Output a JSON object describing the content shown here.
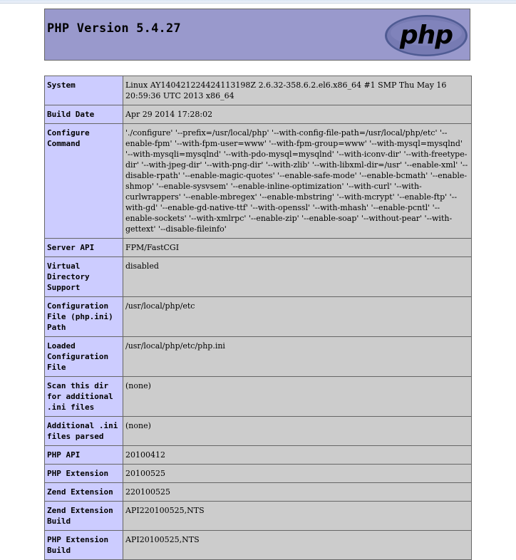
{
  "header": {
    "title": "PHP Version 5.4.27",
    "logo_text": "php",
    "colors": {
      "header_bg": "#9999cc",
      "label_bg": "#ccccff",
      "value_bg": "#cccccc",
      "logo_fill": "#777bb3"
    }
  },
  "rows": [
    {
      "label": "System",
      "value": "Linux AY140421224424113198Z 2.6.32-358.6.2.el6.x86_64 #1 SMP Thu May 16 20:59:36 UTC 2013 x86_64"
    },
    {
      "label": "Build Date",
      "value": "Apr 29 2014 17:28:02"
    },
    {
      "label": "Configure Command",
      "value": "'./configure' '--prefix=/usr/local/php' '--with-config-file-path=/usr/local/php/etc' '--enable-fpm' '--with-fpm-user=www' '--with-fpm-group=www' '--with-mysql=mysqlnd' '--with-mysqli=mysqlnd' '--with-pdo-mysql=mysqlnd' '--with-iconv-dir' '--with-freetype-dir' '--with-jpeg-dir' '--with-png-dir' '--with-zlib' '--with-libxml-dir=/usr' '--enable-xml' '--disable-rpath' '--enable-magic-quotes' '--enable-safe-mode' '--enable-bcmath' '--enable-shmop' '--enable-sysvsem' '--enable-inline-optimization' '--with-curl' '--with-curlwrappers' '--enable-mbregex' '--enable-mbstring' '--with-mcrypt' '--enable-ftp' '--with-gd' '--enable-gd-native-ttf' '--with-openssl' '--with-mhash' '--enable-pcntl' '--enable-sockets' '--with-xmlrpc' '--enable-zip' '--enable-soap' '--without-pear' '--with-gettext' '--disable-fileinfo'"
    },
    {
      "label": "Server API",
      "value": "FPM/FastCGI"
    },
    {
      "label": "Virtual Directory Support",
      "value": "disabled"
    },
    {
      "label": "Configuration File (php.ini) Path",
      "value": "/usr/local/php/etc"
    },
    {
      "label": "Loaded Configuration File",
      "value": "/usr/local/php/etc/php.ini"
    },
    {
      "label": "Scan this dir for additional .ini files",
      "value": "(none)"
    },
    {
      "label": "Additional .ini files parsed",
      "value": "(none)"
    },
    {
      "label": "PHP API",
      "value": "20100412"
    },
    {
      "label": "PHP Extension",
      "value": "20100525"
    },
    {
      "label": "Zend Extension",
      "value": "220100525"
    },
    {
      "label": "Zend Extension Build",
      "value": "API220100525,NTS"
    },
    {
      "label": "PHP Extension Build",
      "value": "API20100525,NTS"
    }
  ]
}
